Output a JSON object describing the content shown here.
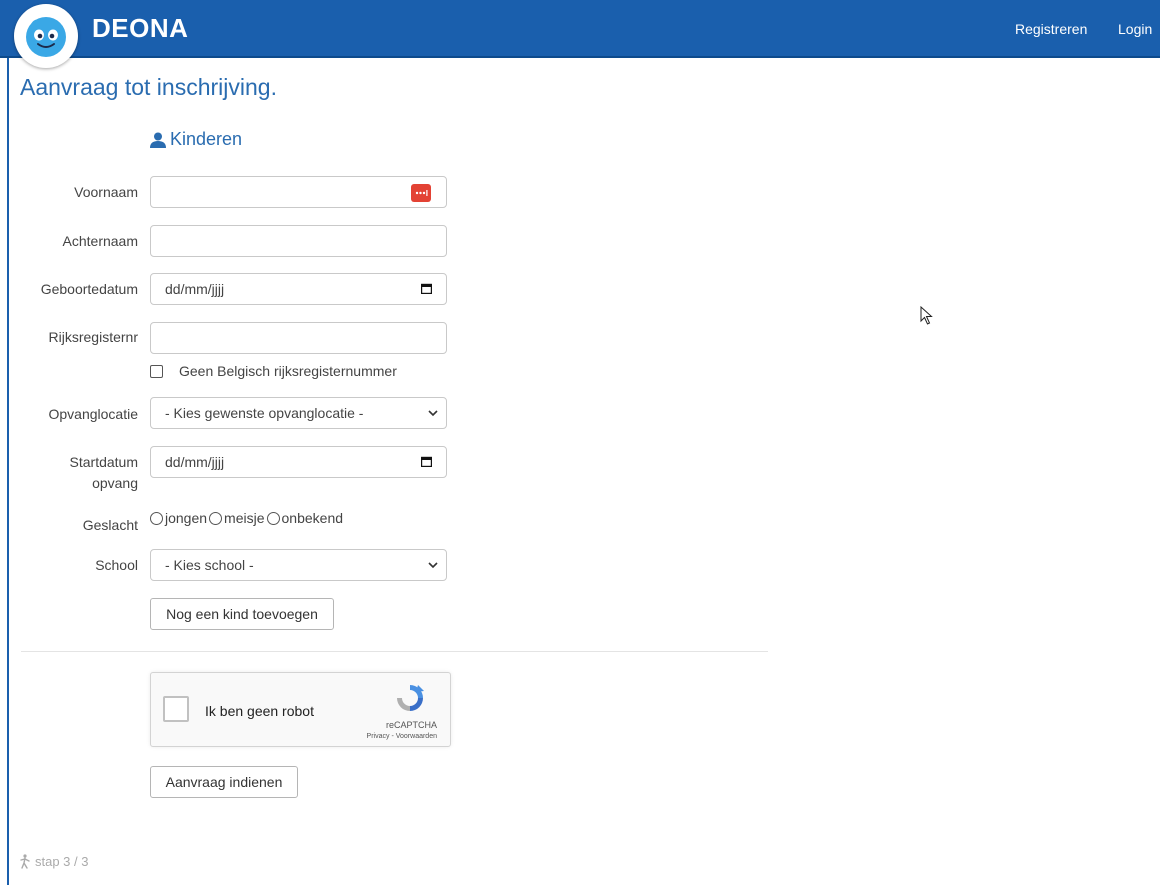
{
  "header": {
    "brand": "DEONA",
    "logo_icon": "smiley-face-icon",
    "nav": [
      {
        "label": "Registreren"
      },
      {
        "label": "Login"
      }
    ]
  },
  "page": {
    "title": "Aanvraag tot inschrijving.",
    "section_title": "Kinderen",
    "section_icon": "user-icon"
  },
  "form": {
    "voornaam": {
      "label": "Voornaam",
      "value": ""
    },
    "achternaam": {
      "label": "Achternaam",
      "value": ""
    },
    "geboortedatum": {
      "label": "Geboortedatum",
      "placeholder": "dd/mm/jjjj"
    },
    "rijksregisternr": {
      "label": "Rijksregisternr",
      "value": ""
    },
    "geen_rrn": {
      "label": "Geen Belgisch rijksregisternummer",
      "checked": false
    },
    "opvanglocatie": {
      "label": "Opvanglocatie",
      "selected": "- Kies gewenste opvanglocatie -"
    },
    "startdatum": {
      "label_line1": "Startdatum",
      "label_line2": "opvang",
      "placeholder": "dd/mm/jjjj"
    },
    "geslacht": {
      "label": "Geslacht",
      "options": [
        {
          "label": "jongen"
        },
        {
          "label": "meisje"
        },
        {
          "label": "onbekend"
        }
      ]
    },
    "school": {
      "label": "School",
      "selected": "- Kies school -"
    },
    "add_child_button": "Nog een kind toevoegen"
  },
  "recaptcha": {
    "label": "Ik ben geen robot",
    "brand": "reCAPTCHA",
    "privacy": "Privacy",
    "separator": " - ",
    "terms": "Voorwaarden"
  },
  "submit_button": "Aanvraag indienen",
  "footer": {
    "step": "stap 3 / 3",
    "step_icon": "walking-person-icon"
  },
  "colors": {
    "brand_blue": "#1a5fad",
    "heading_blue": "#2a6cb0",
    "password_manager_red": "#e34234"
  }
}
